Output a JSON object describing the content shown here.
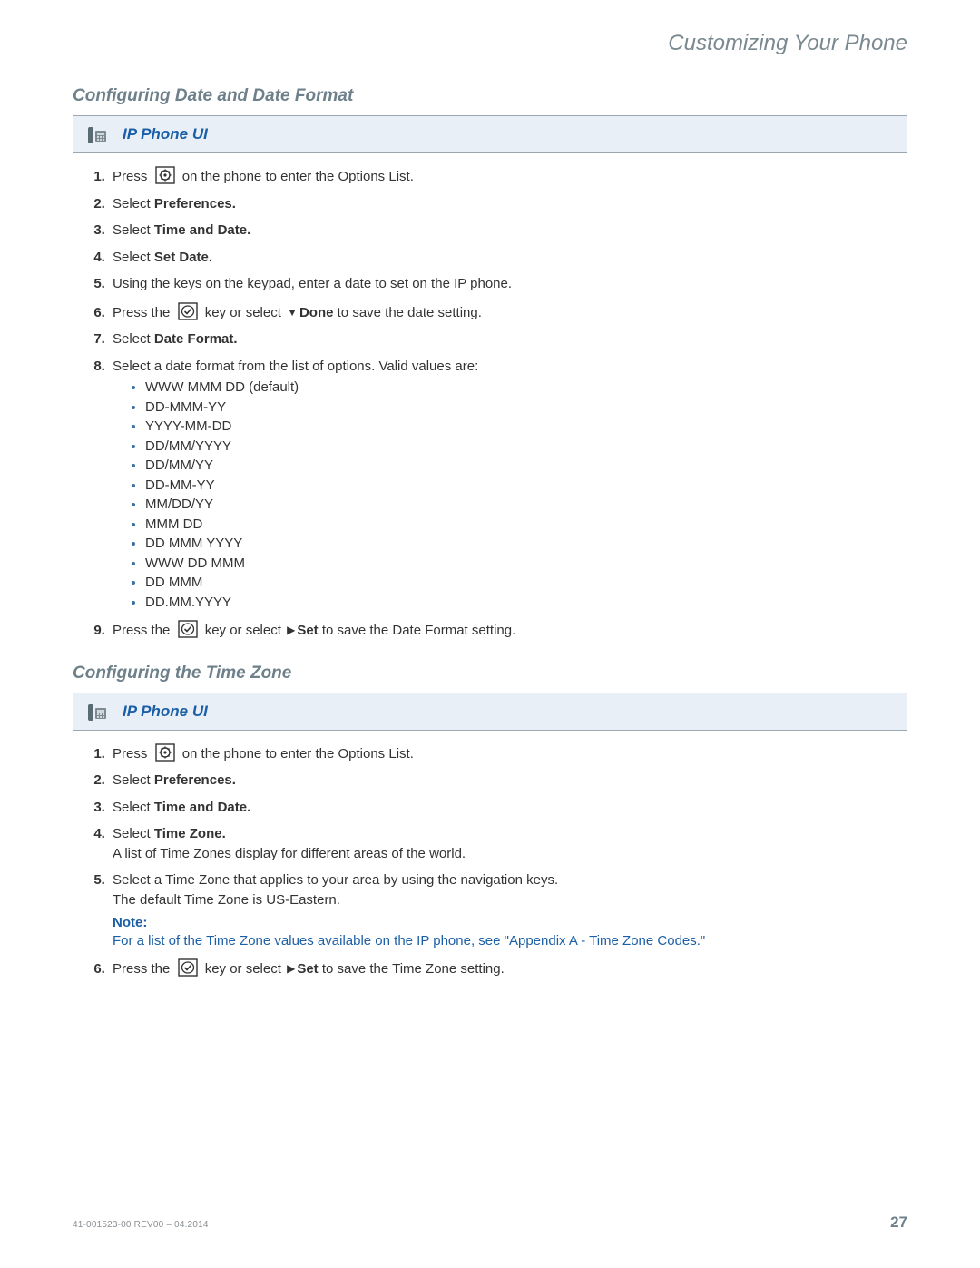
{
  "header": {
    "running": "Customizing Your Phone"
  },
  "section1": {
    "title": "Configuring Date and Date Format",
    "banner": "IP Phone UI",
    "steps": {
      "s1a": "Press ",
      "s1b": " on the phone to enter the Options List.",
      "s2a": "Select ",
      "s2b": "Preferences.",
      "s3a": "Select ",
      "s3b": "Time and Date.",
      "s4a": "Select ",
      "s4b": "Set Date.",
      "s5": "Using the keys on the keypad, enter a date to set on the IP phone.",
      "s6a": "Press the ",
      "s6b": " key or select ",
      "s6c": "Done",
      "s6d": " to save the date setting.",
      "s7a": "Select ",
      "s7b": "Date Format.",
      "s8a": "Select a date format from the list of options. Valid values are:",
      "formats": [
        "WWW MMM DD (default)",
        "DD-MMM-YY",
        "YYYY-MM-DD",
        "DD/MM/YYYY",
        "DD/MM/YY",
        "DD-MM-YY",
        "MM/DD/YY",
        "MMM DD",
        "DD MMM YYYY",
        "WWW DD MMM",
        "DD MMM",
        "DD.MM.YYYY"
      ],
      "s9a": "Press the ",
      "s9b": " key or select ",
      "s9c": "Set",
      "s9d": " to save the Date Format setting."
    }
  },
  "section2": {
    "title": "Configuring the Time Zone",
    "banner": "IP Phone UI",
    "steps": {
      "s1a": "Press ",
      "s1b": " on the phone to enter the Options List.",
      "s2a": "Select ",
      "s2b": "Preferences.",
      "s3a": "Select ",
      "s3b": "Time and Date.",
      "s4a": "Select ",
      "s4b": "Time Zone.",
      "s4c": "A list of Time Zones display for different areas of the world.",
      "s5a": "Select a Time Zone that applies to your area by using the navigation keys.",
      "s5b": "The default Time Zone is US-Eastern.",
      "noteLabel": "Note:",
      "noteBody": "For a list of the Time Zone values available on the IP phone, see ",
      "noteXref": "\"Appendix A - Time Zone Codes.\"",
      "s6a": "Press the ",
      "s6b": " key or select ",
      "s6c": "Set",
      "s6d": " to save the Time Zone setting."
    }
  },
  "footer": {
    "docid": "41-001523-00 REV00 – 04.2014",
    "page": "27"
  }
}
